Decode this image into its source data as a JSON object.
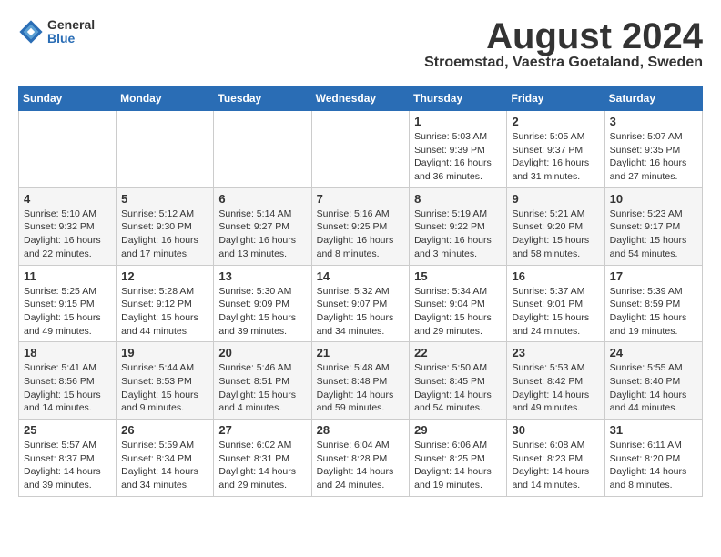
{
  "logo": {
    "general": "General",
    "blue": "Blue"
  },
  "title": "August 2024",
  "subtitle": "Stroemstad, Vaestra Goetaland, Sweden",
  "days_of_week": [
    "Sunday",
    "Monday",
    "Tuesday",
    "Wednesday",
    "Thursday",
    "Friday",
    "Saturday"
  ],
  "weeks": [
    [
      {
        "day": "",
        "info": ""
      },
      {
        "day": "",
        "info": ""
      },
      {
        "day": "",
        "info": ""
      },
      {
        "day": "",
        "info": ""
      },
      {
        "day": "1",
        "info": "Sunrise: 5:03 AM\nSunset: 9:39 PM\nDaylight: 16 hours\nand 36 minutes."
      },
      {
        "day": "2",
        "info": "Sunrise: 5:05 AM\nSunset: 9:37 PM\nDaylight: 16 hours\nand 31 minutes."
      },
      {
        "day": "3",
        "info": "Sunrise: 5:07 AM\nSunset: 9:35 PM\nDaylight: 16 hours\nand 27 minutes."
      }
    ],
    [
      {
        "day": "4",
        "info": "Sunrise: 5:10 AM\nSunset: 9:32 PM\nDaylight: 16 hours\nand 22 minutes."
      },
      {
        "day": "5",
        "info": "Sunrise: 5:12 AM\nSunset: 9:30 PM\nDaylight: 16 hours\nand 17 minutes."
      },
      {
        "day": "6",
        "info": "Sunrise: 5:14 AM\nSunset: 9:27 PM\nDaylight: 16 hours\nand 13 minutes."
      },
      {
        "day": "7",
        "info": "Sunrise: 5:16 AM\nSunset: 9:25 PM\nDaylight: 16 hours\nand 8 minutes."
      },
      {
        "day": "8",
        "info": "Sunrise: 5:19 AM\nSunset: 9:22 PM\nDaylight: 16 hours\nand 3 minutes."
      },
      {
        "day": "9",
        "info": "Sunrise: 5:21 AM\nSunset: 9:20 PM\nDaylight: 15 hours\nand 58 minutes."
      },
      {
        "day": "10",
        "info": "Sunrise: 5:23 AM\nSunset: 9:17 PM\nDaylight: 15 hours\nand 54 minutes."
      }
    ],
    [
      {
        "day": "11",
        "info": "Sunrise: 5:25 AM\nSunset: 9:15 PM\nDaylight: 15 hours\nand 49 minutes."
      },
      {
        "day": "12",
        "info": "Sunrise: 5:28 AM\nSunset: 9:12 PM\nDaylight: 15 hours\nand 44 minutes."
      },
      {
        "day": "13",
        "info": "Sunrise: 5:30 AM\nSunset: 9:09 PM\nDaylight: 15 hours\nand 39 minutes."
      },
      {
        "day": "14",
        "info": "Sunrise: 5:32 AM\nSunset: 9:07 PM\nDaylight: 15 hours\nand 34 minutes."
      },
      {
        "day": "15",
        "info": "Sunrise: 5:34 AM\nSunset: 9:04 PM\nDaylight: 15 hours\nand 29 minutes."
      },
      {
        "day": "16",
        "info": "Sunrise: 5:37 AM\nSunset: 9:01 PM\nDaylight: 15 hours\nand 24 minutes."
      },
      {
        "day": "17",
        "info": "Sunrise: 5:39 AM\nSunset: 8:59 PM\nDaylight: 15 hours\nand 19 minutes."
      }
    ],
    [
      {
        "day": "18",
        "info": "Sunrise: 5:41 AM\nSunset: 8:56 PM\nDaylight: 15 hours\nand 14 minutes."
      },
      {
        "day": "19",
        "info": "Sunrise: 5:44 AM\nSunset: 8:53 PM\nDaylight: 15 hours\nand 9 minutes."
      },
      {
        "day": "20",
        "info": "Sunrise: 5:46 AM\nSunset: 8:51 PM\nDaylight: 15 hours\nand 4 minutes."
      },
      {
        "day": "21",
        "info": "Sunrise: 5:48 AM\nSunset: 8:48 PM\nDaylight: 14 hours\nand 59 minutes."
      },
      {
        "day": "22",
        "info": "Sunrise: 5:50 AM\nSunset: 8:45 PM\nDaylight: 14 hours\nand 54 minutes."
      },
      {
        "day": "23",
        "info": "Sunrise: 5:53 AM\nSunset: 8:42 PM\nDaylight: 14 hours\nand 49 minutes."
      },
      {
        "day": "24",
        "info": "Sunrise: 5:55 AM\nSunset: 8:40 PM\nDaylight: 14 hours\nand 44 minutes."
      }
    ],
    [
      {
        "day": "25",
        "info": "Sunrise: 5:57 AM\nSunset: 8:37 PM\nDaylight: 14 hours\nand 39 minutes."
      },
      {
        "day": "26",
        "info": "Sunrise: 5:59 AM\nSunset: 8:34 PM\nDaylight: 14 hours\nand 34 minutes."
      },
      {
        "day": "27",
        "info": "Sunrise: 6:02 AM\nSunset: 8:31 PM\nDaylight: 14 hours\nand 29 minutes."
      },
      {
        "day": "28",
        "info": "Sunrise: 6:04 AM\nSunset: 8:28 PM\nDaylight: 14 hours\nand 24 minutes."
      },
      {
        "day": "29",
        "info": "Sunrise: 6:06 AM\nSunset: 8:25 PM\nDaylight: 14 hours\nand 19 minutes."
      },
      {
        "day": "30",
        "info": "Sunrise: 6:08 AM\nSunset: 8:23 PM\nDaylight: 14 hours\nand 14 minutes."
      },
      {
        "day": "31",
        "info": "Sunrise: 6:11 AM\nSunset: 8:20 PM\nDaylight: 14 hours\nand 8 minutes."
      }
    ]
  ]
}
